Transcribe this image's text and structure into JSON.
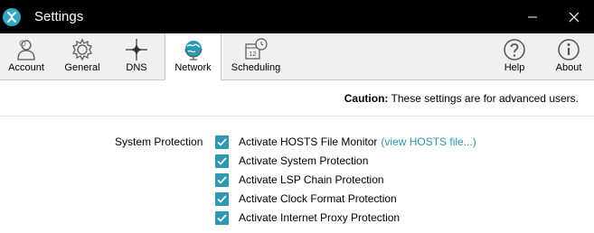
{
  "window": {
    "title": "Settings",
    "minimize_glyph": "—",
    "close_glyph": "✕"
  },
  "toolbar": {
    "left_tabs": [
      {
        "label": "Account",
        "icon": "person-icon"
      },
      {
        "label": "General",
        "icon": "gear-icon"
      },
      {
        "label": "DNS",
        "icon": "crosshair-icon"
      },
      {
        "label": "Network",
        "icon": "globe-icon",
        "active": true
      },
      {
        "label": "Scheduling",
        "icon": "calendar-clock-icon"
      }
    ],
    "right_buttons": [
      {
        "label": "Help",
        "icon": "question-icon"
      },
      {
        "label": "About",
        "icon": "info-icon"
      }
    ],
    "calendar_day": "12"
  },
  "content": {
    "caution_bold": "Caution:",
    "caution_text": "These settings are for advanced users.",
    "section_label": "System Protection",
    "options": [
      {
        "label": "Activate HOSTS File Monitor",
        "checked": true,
        "link": "(view HOSTS file...)"
      },
      {
        "label": "Activate System Protection",
        "checked": true
      },
      {
        "label": "Activate LSP Chain Protection",
        "checked": true
      },
      {
        "label": "Activate Clock Format Protection",
        "checked": true
      },
      {
        "label": "Activate Internet Proxy Protection",
        "checked": true
      }
    ]
  },
  "colors": {
    "accent": "#2b98b4",
    "titlebar": "#000000",
    "toolbar_bg": "#f0f0f0"
  }
}
